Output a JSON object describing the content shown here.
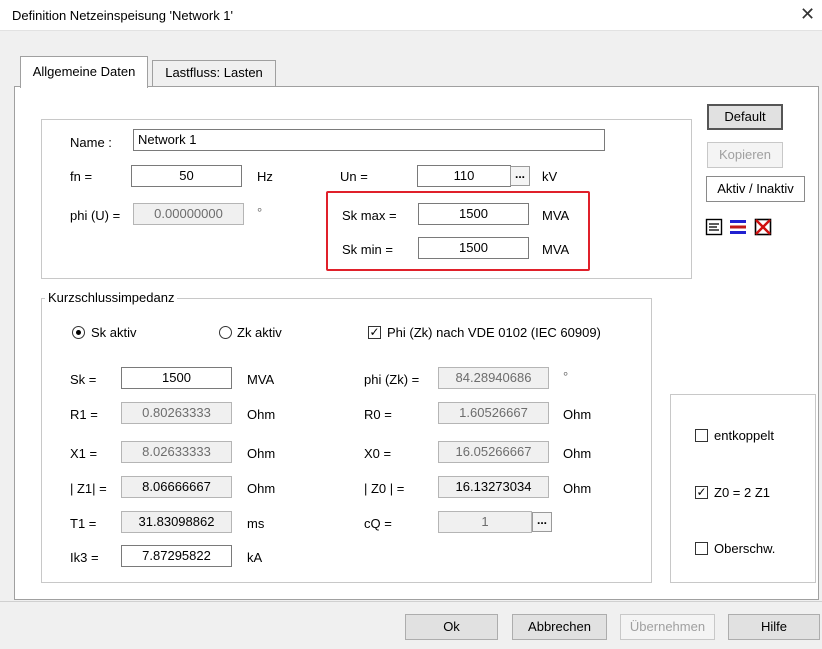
{
  "window": {
    "title": "Definition Netzeinspeisung 'Network 1'",
    "close_glyph": "✕"
  },
  "tabs": [
    {
      "label": "Allgemeine Daten",
      "active": true
    },
    {
      "label": "Lastfluss: Lasten",
      "active": false
    }
  ],
  "general": {
    "name_label": "Name :",
    "name_value": "Network 1",
    "fn_label": "fn =",
    "fn_value": "50",
    "fn_unit": "Hz",
    "un_label": "Un =",
    "un_value": "110",
    "un_unit": "kV",
    "phiu_label": "phi (U) =",
    "phiu_value": "0.00000000",
    "phiu_unit": "°",
    "skmax_label": "Sk max =",
    "skmax_value": "1500",
    "skmax_unit": "MVA",
    "skmin_label": "Sk min =",
    "skmin_value": "1500",
    "skmin_unit": "MVA",
    "dots": "..."
  },
  "side_buttons": {
    "default": "Default",
    "copy": "Kopieren",
    "activate": "Aktiv / Inaktiv"
  },
  "sc": {
    "legend": "Kurzschlussimpedanz",
    "radio_sk": "Sk aktiv",
    "radio_zk": "Zk aktiv",
    "phi_check_label": "Phi (Zk) nach VDE 0102 (IEC 60909)",
    "phi_check_mark": "✓",
    "sk_label": "Sk =",
    "sk_value": "1500",
    "sk_unit": "MVA",
    "r1_label": "R1 =",
    "r1_value": "0.80263333",
    "r1_unit": "Ohm",
    "x1_label": "X1 =",
    "x1_value": "8.02633333",
    "x1_unit": "Ohm",
    "z1_label": "| Z1| =",
    "z1_value": "8.06666667",
    "z1_unit": "Ohm",
    "t1_label": "T1 =",
    "t1_value": "31.83098862",
    "t1_unit": "ms",
    "ik3_label": "Ik3 =",
    "ik3_value": "7.87295822",
    "ik3_unit": "kA",
    "phizk_label": "phi (Zk) =",
    "phizk_value": "84.28940686",
    "phizk_unit": "°",
    "r0_label": "R0 =",
    "r0_value": "1.60526667",
    "r0_unit": "Ohm",
    "x0_label": "X0 =",
    "x0_value": "16.05266667",
    "x0_unit": "Ohm",
    "z0_label": "| Z0 | =",
    "z0_value": "16.13273034",
    "z0_unit": "Ohm",
    "cq_label": "cQ =",
    "cq_value": "1",
    "dots": "..."
  },
  "options": {
    "decoupled": "entkoppelt",
    "z0": "Z0 = 2 Z1",
    "z0_mark": "✓",
    "harmonics": "Oberschw."
  },
  "bottom_buttons": {
    "ok": "Ok",
    "cancel": "Abbrechen",
    "apply": "Übernehmen",
    "help": "Hilfe"
  }
}
